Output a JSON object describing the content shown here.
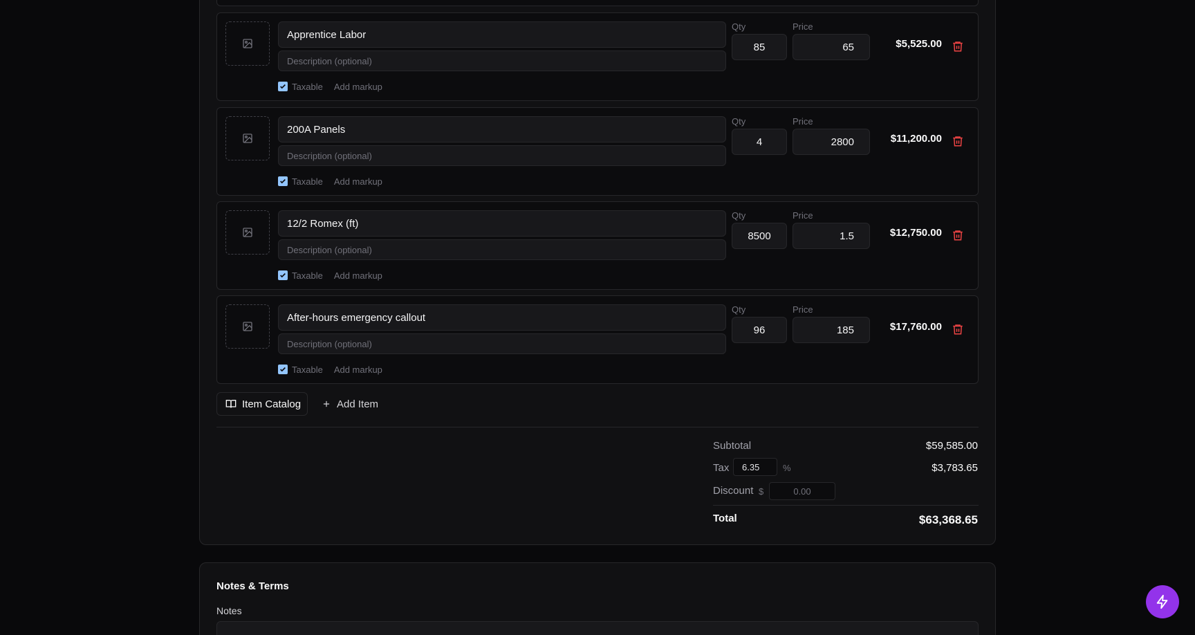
{
  "items": [
    {
      "name": "Apprentice Labor",
      "description_placeholder": "Description (optional)",
      "taxable_label": "Taxable",
      "markup_label": "Add markup",
      "qty_label": "Qty",
      "price_label": "Price",
      "qty": "85",
      "price": "65",
      "total": "$5,525.00"
    },
    {
      "name": "200A Panels",
      "description_placeholder": "Description (optional)",
      "taxable_label": "Taxable",
      "markup_label": "Add markup",
      "qty_label": "Qty",
      "price_label": "Price",
      "qty": "4",
      "price": "2800",
      "total": "$11,200.00"
    },
    {
      "name": "12/2 Romex (ft)",
      "description_placeholder": "Description (optional)",
      "taxable_label": "Taxable",
      "markup_label": "Add markup",
      "qty_label": "Qty",
      "price_label": "Price",
      "qty": "8500",
      "price": "1.5",
      "total": "$12,750.00"
    },
    {
      "name": "After-hours emergency callout",
      "description_placeholder": "Description (optional)",
      "taxable_label": "Taxable",
      "markup_label": "Add markup",
      "qty_label": "Qty",
      "price_label": "Price",
      "qty": "96",
      "price": "185",
      "total": "$17,760.00"
    }
  ],
  "actions": {
    "catalog_label": "Item Catalog",
    "add_label": "Add Item"
  },
  "summary": {
    "subtotal_label": "Subtotal",
    "subtotal": "$59,585.00",
    "tax_label": "Tax",
    "tax_rate": "6.35",
    "tax_unit": "%",
    "tax_amount": "$3,783.65",
    "discount_label": "Discount",
    "discount_currency": "$",
    "discount_placeholder": "0.00",
    "total_label": "Total",
    "total": "$63,368.65"
  },
  "notes": {
    "section_title": "Notes & Terms",
    "notes_label": "Notes"
  },
  "colors": {
    "accent": "#9333ea",
    "delete": "#ef4444",
    "checkbox": "#93c5fd"
  }
}
